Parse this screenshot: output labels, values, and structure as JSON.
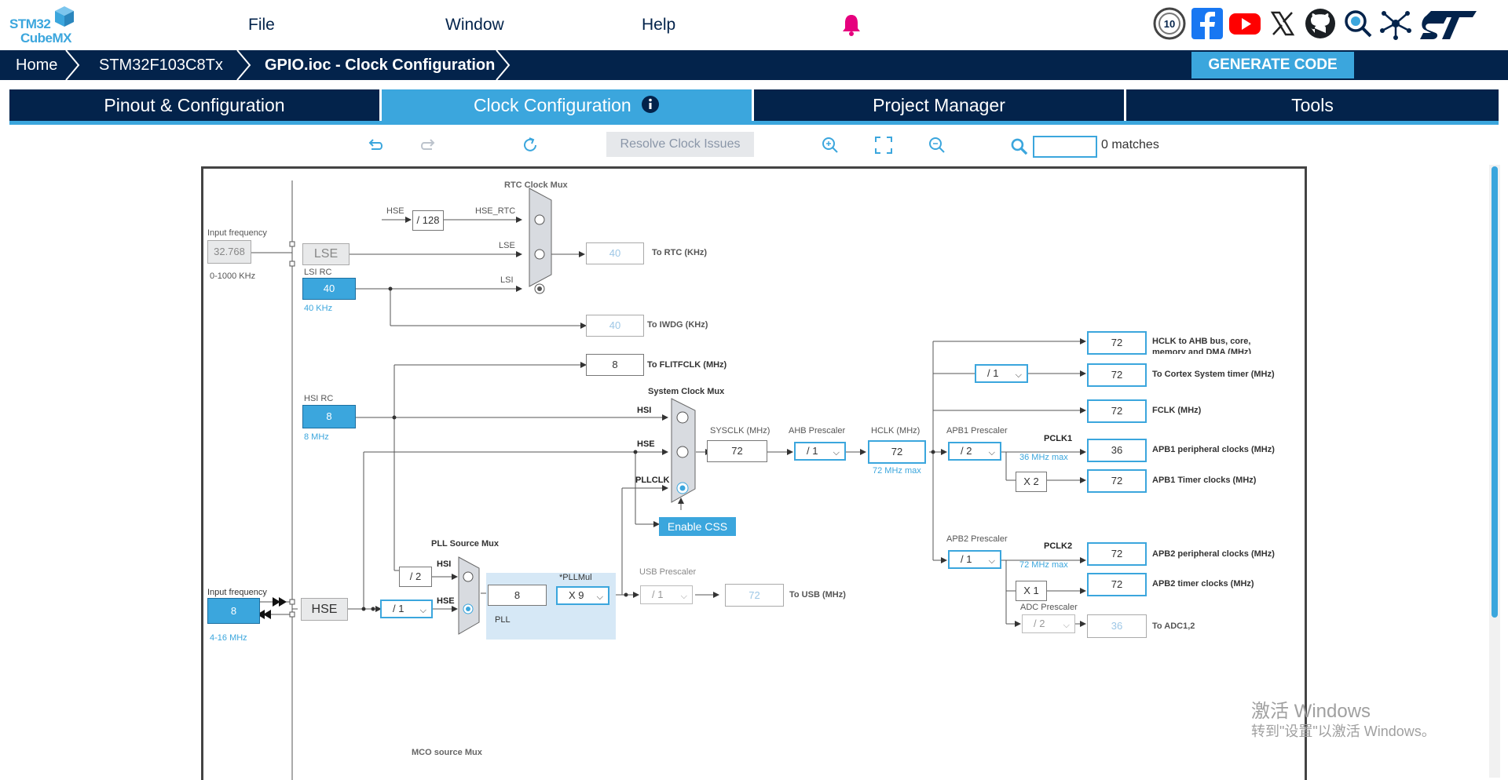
{
  "app": {
    "logo_line1": "STM32",
    "logo_line2": "CubeMX"
  },
  "menu": {
    "file": "File",
    "window": "Window",
    "help": "Help"
  },
  "icons": {
    "bell": "bell-icon",
    "anniversary": "tenth-anniversary-badge-icon",
    "facebook": "facebook-icon",
    "youtube": "youtube-icon",
    "x": "x-twitter-icon",
    "github": "github-icon",
    "community": "community-search-icon",
    "network": "network-icon",
    "st": "st-logo-icon"
  },
  "breadcrumb": [
    "Home",
    "STM32F103C8Tx",
    "GPIO.ioc - Clock Configuration"
  ],
  "generate_button": "GENERATE CODE",
  "tabs": [
    {
      "label": "Pinout & Configuration",
      "active": false
    },
    {
      "label": "Clock Configuration",
      "active": true
    },
    {
      "label": "Project Manager",
      "active": false
    },
    {
      "label": "Tools",
      "active": false
    }
  ],
  "toolbar": {
    "resolve": "Resolve Clock Issues",
    "search_value": "",
    "matches": "0 matches"
  },
  "colors": {
    "navy": "#03234b",
    "accent": "#3ba6dd",
    "pink": "#e6007e"
  },
  "clock": {
    "lse_input_label": "Input frequency",
    "lse_input_value": "32.768",
    "lse_range": "0-1000 KHz",
    "lse": "LSE",
    "lsi_rc_label": "LSI RC",
    "lsi_value": "40",
    "lsi_freq": "40 KHz",
    "rtc_mux_title": "RTC Clock Mux",
    "hse_label": "HSE",
    "div128": "/ 128",
    "hse_rtc": "HSE_RTC",
    "lse_label": "LSE",
    "lsi_label": "LSI",
    "to_rtc_value": "40",
    "to_rtc_label": "To RTC (KHz)",
    "to_iwdg_value": "40",
    "to_iwdg_label": "To IWDG (KHz)",
    "flitf_value": "8",
    "flitf_label": "To FLITFCLK (MHz)",
    "hsi_rc_label": "HSI RC",
    "hsi_value": "8",
    "hsi_freq": "8 MHz",
    "sys_mux_title": "System Clock Mux",
    "hsi_label": "HSI",
    "pllclk_label": "PLLCLK",
    "sysclk_label": "SYSCLK (MHz)",
    "sysclk_value": "72",
    "ahb_label": "AHB Prescaler",
    "ahb_value": "/ 1",
    "hclk_label": "HCLK (MHz)",
    "hclk_value": "72",
    "hclk_max": "72 MHz max",
    "enable_css": "Enable CSS",
    "apb1_label": "APB1 Prescaler",
    "apb1_value": "/ 2",
    "pclk1": "PCLK1",
    "pclk1_max": "36 MHz max",
    "apb2_label": "APB2 Prescaler",
    "apb2_value": "/ 1",
    "pclk2": "PCLK2",
    "pclk2_max": "72 MHz max",
    "x2": "X 2",
    "x1": "X 1",
    "cortex_div": "/ 1",
    "out_hclk_value": "72",
    "out_hclk_label1": "HCLK to AHB bus, core,",
    "out_hclk_label2": "memory and DMA (MHz)",
    "out_cortex_value": "72",
    "out_cortex_label": "To Cortex System timer (MHz)",
    "out_fclk_value": "72",
    "out_fclk_label": "FCLK (MHz)",
    "out_apb1p_value": "36",
    "out_apb1p_label": "APB1 peripheral clocks (MHz)",
    "out_apb1t_value": "72",
    "out_apb1t_label": "APB1 Timer clocks (MHz)",
    "out_apb2p_value": "72",
    "out_apb2p_label": "APB2 peripheral clocks (MHz)",
    "out_apb2t_value": "72",
    "out_apb2t_label": "APB2 timer clocks (MHz)",
    "adc_label": "ADC Prescaler",
    "adc_value": "/ 2",
    "out_adc_value": "36",
    "out_adc_label": "To ADC1,2",
    "pll_src_title": "PLL Source Mux",
    "div2": "/ 2",
    "hse_div": "/ 1",
    "pll_input": "8",
    "pll_label": "PLL",
    "pllmul_label": "*PLLMul",
    "pllmul_value": "X 9",
    "usb_label": "USB Prescaler",
    "usb_value": "/ 1",
    "usb_out_value": "72",
    "usb_out_label": "To USB (MHz)",
    "hse_input_label": "Input frequency",
    "hse_input_value": "8",
    "hse_range": "4-16 MHz",
    "hse_box": "HSE",
    "mco_title": "MCO source Mux"
  },
  "watermark": {
    "line1": "激活 Windows",
    "line2": "转到\"设置\"以激活 Windows。"
  }
}
